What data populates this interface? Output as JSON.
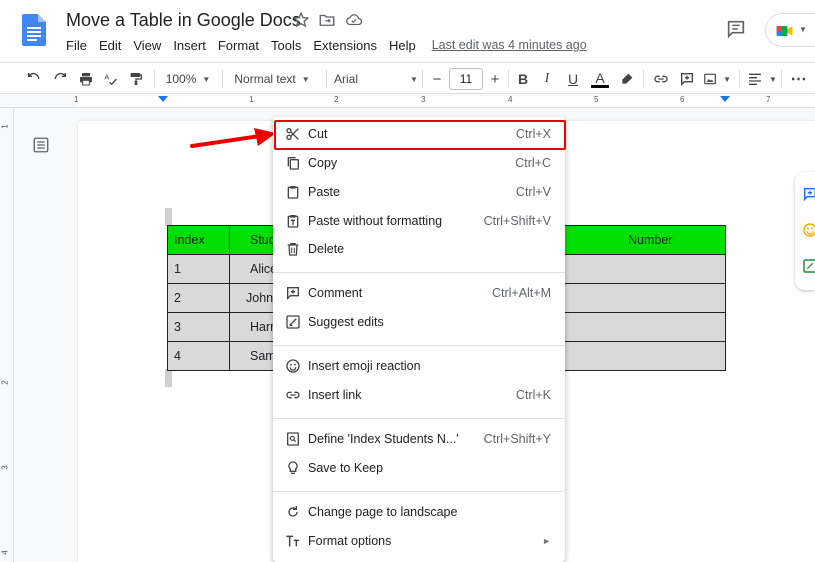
{
  "header": {
    "title": "Move a Table in Google Docs",
    "menu": [
      "File",
      "Edit",
      "View",
      "Insert",
      "Format",
      "Tools",
      "Extensions",
      "Help"
    ],
    "last_edit": "Last edit was 4 minutes ago"
  },
  "toolbar": {
    "zoom": "100%",
    "style": "Normal text",
    "font": "Arial",
    "font_size": "11",
    "font_decrement": "−",
    "font_increment": "+",
    "bold": "B",
    "italic": "I",
    "underline": "U",
    "text_color": "A"
  },
  "ruler": {
    "numbers": [
      "1",
      "1",
      "2",
      "3",
      "4",
      "5",
      "6",
      "7"
    ],
    "vertical_numbers": [
      "1",
      "2",
      "3",
      "4"
    ]
  },
  "table": {
    "header": [
      "Index",
      "Stud",
      "Number"
    ],
    "rows": [
      [
        "1",
        "Alice",
        ""
      ],
      [
        "2",
        "John",
        ""
      ],
      [
        "3",
        "Harr",
        ""
      ],
      [
        "4",
        "Sam",
        ""
      ]
    ],
    "header_color": "#00e000",
    "row_color": "#d9d9d9"
  },
  "context_menu": {
    "items": [
      {
        "label": "Cut",
        "shortcut": "Ctrl+X",
        "icon": "scissors-icon"
      },
      {
        "label": "Copy",
        "shortcut": "Ctrl+C",
        "icon": "copy-icon"
      },
      {
        "label": "Paste",
        "shortcut": "Ctrl+V",
        "icon": "clipboard-icon"
      },
      {
        "label": "Paste without formatting",
        "shortcut": "Ctrl+Shift+V",
        "icon": "paste-plain-icon"
      },
      {
        "label": "Delete",
        "shortcut": "",
        "icon": "trash-icon"
      },
      {
        "label": "Comment",
        "shortcut": "Ctrl+Alt+M",
        "icon": "add-comment-icon"
      },
      {
        "label": "Suggest edits",
        "shortcut": "",
        "icon": "suggest-edit-icon"
      },
      {
        "label": "Insert emoji reaction",
        "shortcut": "",
        "icon": "emoji-icon"
      },
      {
        "label": "Insert link",
        "shortcut": "Ctrl+K",
        "icon": "link-icon"
      },
      {
        "label": "Define 'Index Students N...'",
        "shortcut": "Ctrl+Shift+Y",
        "icon": "define-icon"
      },
      {
        "label": "Save to Keep",
        "shortcut": "",
        "icon": "lightbulb-icon"
      },
      {
        "label": "Change page to landscape",
        "shortcut": "",
        "icon": "rotate-icon"
      },
      {
        "label": "Format options",
        "shortcut": "",
        "icon": "format-text-icon"
      }
    ],
    "submenu_arrow": "►",
    "highlight_color": "#e00000"
  }
}
